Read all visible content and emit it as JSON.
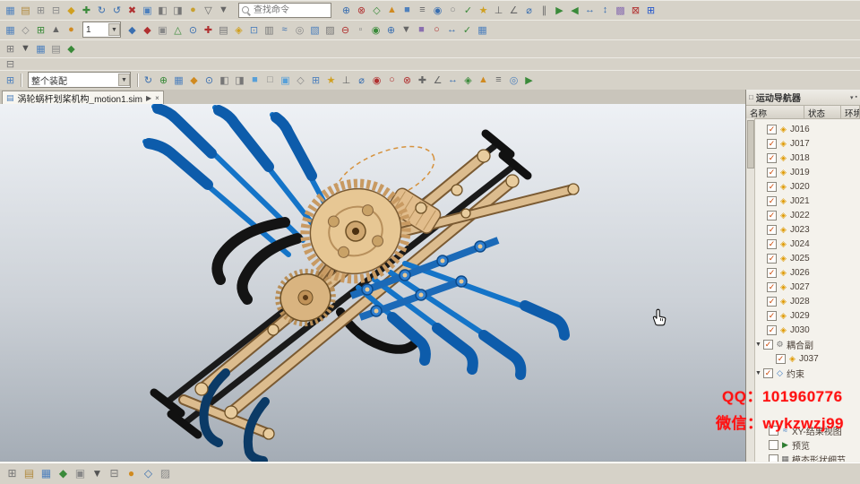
{
  "command_finder": {
    "placeholder": "查找命令"
  },
  "tab": {
    "title": "涡轮蜗杆划桨机构_motion1.sim",
    "detach": "▶",
    "close": "×"
  },
  "toolbars": {
    "row2_combo": "1",
    "assembly_combo": "整个装配",
    "row1a": [
      {
        "g": "▦",
        "c": "#4f81bd"
      },
      {
        "g": "▤",
        "c": "#b08a3e"
      },
      {
        "g": "⊞",
        "c": "#8a8a8a"
      },
      {
        "g": "⊟",
        "c": "#8a8a8a"
      },
      {
        "g": "◆",
        "c": "#d0a020"
      },
      {
        "g": "✚",
        "c": "#3a8a3a"
      },
      {
        "g": "↻",
        "c": "#3a6fb0"
      },
      {
        "g": "↺",
        "c": "#3a6fb0"
      },
      {
        "g": "✖",
        "c": "#b03030"
      },
      {
        "g": "▣",
        "c": "#4f81bd"
      },
      {
        "g": "◧",
        "c": "#777777"
      },
      {
        "g": "◨",
        "c": "#777777"
      },
      {
        "g": "●",
        "c": "#c8a030"
      },
      {
        "g": "▽",
        "c": "#666666"
      },
      {
        "g": "▼",
        "c": "#666666"
      }
    ],
    "row1b": [
      {
        "g": "⊕",
        "c": "#3a6fb0"
      },
      {
        "g": "⊗",
        "c": "#b03030"
      },
      {
        "g": "◇",
        "c": "#3a8a3a"
      },
      {
        "g": "▲",
        "c": "#d08a20"
      },
      {
        "g": "■",
        "c": "#4f81bd"
      },
      {
        "g": "≡",
        "c": "#666666"
      },
      {
        "g": "◉",
        "c": "#3a6fb0"
      },
      {
        "g": "○",
        "c": "#888888"
      },
      {
        "g": "✓",
        "c": "#3a8a3a"
      },
      {
        "g": "★",
        "c": "#d0a020"
      },
      {
        "g": "⊥",
        "c": "#666666"
      },
      {
        "g": "∠",
        "c": "#666666"
      },
      {
        "g": "⌀",
        "c": "#3a6fb0"
      },
      {
        "g": "∥",
        "c": "#666666"
      },
      {
        "g": "▶",
        "c": "#3a8a3a"
      },
      {
        "g": "◀",
        "c": "#3a8a3a"
      },
      {
        "g": "↔",
        "c": "#3a6fb0"
      },
      {
        "g": "↕",
        "c": "#3a6fb0"
      },
      {
        "g": "▩",
        "c": "#8a6fb0"
      },
      {
        "g": "⊠",
        "c": "#b03030"
      },
      {
        "g": "⊞",
        "c": "#2255cc"
      }
    ],
    "row2a": [
      {
        "g": "▦",
        "c": "#4f81bd"
      },
      {
        "g": "◇",
        "c": "#888888"
      },
      {
        "g": "⊞",
        "c": "#3a8a3a"
      },
      {
        "g": "▲",
        "c": "#666666"
      },
      {
        "g": "●",
        "c": "#d08a20"
      }
    ],
    "row2b": [
      {
        "g": "◆",
        "c": "#3a6fb0"
      },
      {
        "g": "◆",
        "c": "#b03030"
      },
      {
        "g": "▣",
        "c": "#888888"
      },
      {
        "g": "△",
        "c": "#3a8a3a"
      },
      {
        "g": "⊙",
        "c": "#3a6fb0"
      },
      {
        "g": "✚",
        "c": "#b03030"
      },
      {
        "g": "▤",
        "c": "#777777"
      },
      {
        "g": "◈",
        "c": "#d0a020"
      },
      {
        "g": "⊡",
        "c": "#4f81bd"
      },
      {
        "g": "▥",
        "c": "#777777"
      },
      {
        "g": "≈",
        "c": "#3a6fb0"
      },
      {
        "g": "◎",
        "c": "#888888"
      },
      {
        "g": "▧",
        "c": "#4f81bd"
      },
      {
        "g": "▨",
        "c": "#777777"
      },
      {
        "g": "⊖",
        "c": "#b03030"
      },
      {
        "g": "▫",
        "c": "#888888"
      },
      {
        "g": "◉",
        "c": "#3a8a3a"
      },
      {
        "g": "⊕",
        "c": "#3a6fb0"
      },
      {
        "g": "▼",
        "c": "#666666"
      },
      {
        "g": "■",
        "c": "#8a6fb0"
      },
      {
        "g": "○",
        "c": "#b03030"
      },
      {
        "g": "↔",
        "c": "#3a6fb0"
      },
      {
        "g": "✓",
        "c": "#3a8a3a"
      },
      {
        "g": "▦",
        "c": "#4f81bd"
      }
    ],
    "row3": [
      {
        "g": "⊞",
        "c": "#777777"
      },
      {
        "g": "▼",
        "c": "#555555"
      },
      {
        "g": "▦",
        "c": "#4f81bd"
      },
      {
        "g": "▤",
        "c": "#888888"
      },
      {
        "g": "◆",
        "c": "#3a8a3a"
      }
    ],
    "row4": [
      {
        "g": "⊟",
        "c": "#777777"
      }
    ],
    "row5a": [
      {
        "g": "⊞",
        "c": "#4f81bd"
      }
    ],
    "row5b": [
      {
        "g": "↻",
        "c": "#3a6fb0"
      },
      {
        "g": "⊕",
        "c": "#3a8a3a"
      },
      {
        "g": "▦",
        "c": "#4f81bd"
      },
      {
        "g": "◆",
        "c": "#d08a20"
      },
      {
        "g": "⊙",
        "c": "#3a6fb0"
      },
      {
        "g": "◧",
        "c": "#777777"
      },
      {
        "g": "◨",
        "c": "#777777"
      },
      {
        "g": "■",
        "c": "#58a0d8"
      },
      {
        "g": "□",
        "c": "#888888"
      },
      {
        "g": "▣",
        "c": "#58a0d8"
      },
      {
        "g": "◇",
        "c": "#888888"
      },
      {
        "g": "⊞",
        "c": "#4f81bd"
      },
      {
        "g": "★",
        "c": "#d0a020"
      },
      {
        "g": "⊥",
        "c": "#666666"
      },
      {
        "g": "⌀",
        "c": "#3a6fb0"
      },
      {
        "g": "◉",
        "c": "#b03030"
      },
      {
        "g": "○",
        "c": "#b03030"
      },
      {
        "g": "⊗",
        "c": "#b03030"
      },
      {
        "g": "✚",
        "c": "#666666"
      },
      {
        "g": "∠",
        "c": "#666666"
      },
      {
        "g": "↔",
        "c": "#3a6fb0"
      },
      {
        "g": "◈",
        "c": "#3a8a3a"
      },
      {
        "g": "▲",
        "c": "#d08a20"
      },
      {
        "g": "≡",
        "c": "#666666"
      },
      {
        "g": "◎",
        "c": "#4f81bd"
      },
      {
        "g": "▶",
        "c": "#3a8a3a"
      }
    ],
    "bottom": [
      {
        "g": "⊞",
        "c": "#777777"
      },
      {
        "g": "▤",
        "c": "#b08a3e"
      },
      {
        "g": "▦",
        "c": "#4f81bd"
      },
      {
        "g": "◆",
        "c": "#3a8a3a"
      },
      {
        "g": "▣",
        "c": "#888888"
      },
      {
        "g": "▼",
        "c": "#555555"
      },
      {
        "g": "⊟",
        "c": "#777777"
      },
      {
        "g": "●",
        "c": "#d08a20"
      },
      {
        "g": "◇",
        "c": "#3a6fb0"
      },
      {
        "g": "▨",
        "c": "#888888"
      }
    ]
  },
  "navigator": {
    "title": "运动导航器",
    "columns": [
      "名称",
      "状态",
      "环境"
    ],
    "items": [
      {
        "label": "J016",
        "check": "✓",
        "icon": "◈",
        "icon_color": "#e09a00",
        "arrow": "",
        "pad": "4px",
        "vis": "visible"
      },
      {
        "label": "J017",
        "check": "✓",
        "icon": "◈",
        "icon_color": "#e09a00",
        "arrow": "",
        "pad": "4px",
        "vis": "visible"
      },
      {
        "label": "J018",
        "check": "✓",
        "icon": "◈",
        "icon_color": "#e09a00",
        "arrow": "",
        "pad": "4px",
        "vis": "visible"
      },
      {
        "label": "J019",
        "check": "✓",
        "icon": "◈",
        "icon_color": "#e09a00",
        "arrow": "",
        "pad": "4px",
        "vis": "visible"
      },
      {
        "label": "J020",
        "check": "✓",
        "icon": "◈",
        "icon_color": "#e09a00",
        "arrow": "",
        "pad": "4px",
        "vis": "visible"
      },
      {
        "label": "J021",
        "check": "✓",
        "icon": "◈",
        "icon_color": "#e09a00",
        "arrow": "",
        "pad": "4px",
        "vis": "visible"
      },
      {
        "label": "J022",
        "check": "✓",
        "icon": "◈",
        "icon_color": "#e09a00",
        "arrow": "",
        "pad": "4px",
        "vis": "visible"
      },
      {
        "label": "J023",
        "check": "✓",
        "icon": "◈",
        "icon_color": "#e09a00",
        "arrow": "",
        "pad": "4px",
        "vis": "visible"
      },
      {
        "label": "J024",
        "check": "✓",
        "icon": "◈",
        "icon_color": "#e09a00",
        "arrow": "",
        "pad": "4px",
        "vis": "visible"
      },
      {
        "label": "J025",
        "check": "✓",
        "icon": "◈",
        "icon_color": "#e09a00",
        "arrow": "",
        "pad": "4px",
        "vis": "visible"
      },
      {
        "label": "J026",
        "check": "✓",
        "icon": "◈",
        "icon_color": "#e09a00",
        "arrow": "",
        "pad": "4px",
        "vis": "visible"
      },
      {
        "label": "J027",
        "check": "✓",
        "icon": "◈",
        "icon_color": "#e09a00",
        "arrow": "",
        "pad": "4px",
        "vis": "visible"
      },
      {
        "label": "J028",
        "check": "✓",
        "icon": "◈",
        "icon_color": "#e09a00",
        "arrow": "",
        "pad": "4px",
        "vis": "visible"
      },
      {
        "label": "J029",
        "check": "✓",
        "icon": "◈",
        "icon_color": "#e09a00",
        "arrow": "",
        "pad": "4px",
        "vis": "visible"
      },
      {
        "label": "J030",
        "check": "✓",
        "icon": "◈",
        "icon_color": "#e09a00",
        "arrow": "",
        "pad": "4px",
        "vis": "visible"
      },
      {
        "label": "耦合副",
        "check": "✓",
        "icon": "⚙",
        "icon_color": "#777777",
        "arrow": "▼",
        "pad": "0px",
        "vis": "visible"
      },
      {
        "label": "J037",
        "check": "✓",
        "icon": "◈",
        "icon_color": "#e09a00",
        "arrow": "",
        "pad": "14px",
        "vis": "visible"
      },
      {
        "label": "约束",
        "check": "✓",
        "icon": "◇",
        "icon_color": "#3a78c0",
        "arrow": "▼",
        "pad": "0px",
        "vis": "visible"
      },
      {
        "label": "",
        "check": "",
        "icon": "",
        "icon_color": "",
        "arrow": "",
        "pad": "0px",
        "vis": "hidden"
      },
      {
        "label": "",
        "check": "",
        "icon": "",
        "icon_color": "",
        "arrow": "",
        "pad": "0px",
        "vis": "hidden"
      },
      {
        "label": "",
        "check": "",
        "icon": "",
        "icon_color": "",
        "arrow": "",
        "pad": "0px",
        "vis": "hidden"
      },
      {
        "label": "XY-结果视图",
        "check": "",
        "icon": "≈",
        "icon_color": "#3a78c0",
        "arrow": "",
        "pad": "6px",
        "vis": "visible"
      },
      {
        "label": "预览",
        "check": "",
        "icon": "▶",
        "icon_color": "#2e7d32",
        "arrow": "",
        "pad": "6px",
        "vis": "visible"
      },
      {
        "label": "模态形状细节",
        "check": "",
        "icon": "▦",
        "icon_color": "#666666",
        "arrow": "",
        "pad": "6px",
        "vis": "visible"
      }
    ]
  },
  "watermark": {
    "line1": "QQ：101960776",
    "line2": "微信：wykzwzj99"
  }
}
